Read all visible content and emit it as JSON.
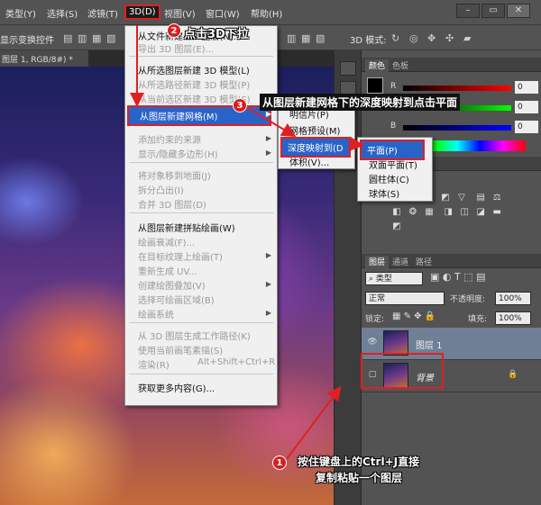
{
  "menubar": {
    "items": [
      "类型(Y)",
      "选择(S)",
      "滤镜(T)",
      "3D(D)",
      "视图(V)",
      "窗口(W)",
      "帮助(H)"
    ],
    "window_controls": [
      "minimize-icon",
      "restore-icon",
      "close-icon"
    ]
  },
  "options_bar": {
    "show_transform": "显示变换控件",
    "mode_label": "3D 模式:"
  },
  "document": {
    "tab_title": "图层 1, RGB/8#) *"
  },
  "menu3d": {
    "items": [
      {
        "label": "从文件新建 3D 图层(N)...",
        "disabled": false
      },
      {
        "label": "导出 3D 图层(E)...",
        "disabled": true
      },
      {
        "label": "从所选图层新建 3D 模型(L)",
        "disabled": false
      },
      {
        "label": "从所选路径新建 3D 模型(P)",
        "disabled": true
      },
      {
        "label": "从当前选区新建 3D 模型(S)",
        "disabled": true
      },
      {
        "label": "从图层新建网格(M)",
        "disabled": false,
        "highlighted": true,
        "submenu": true
      },
      {
        "label": "添加约束的来源",
        "disabled": true,
        "submenu": true
      },
      {
        "label": "显示/隐藏多边形(H)",
        "disabled": true,
        "submenu": true
      },
      {
        "label": "将对象移到地面(J)",
        "disabled": true
      },
      {
        "label": "拆分凸出(I)",
        "disabled": true
      },
      {
        "label": "合并 3D 图层(D)",
        "disabled": true
      },
      {
        "label": "从图层新建拼贴绘画(W)",
        "disabled": false
      },
      {
        "label": "绘画衰减(F)...",
        "disabled": true
      },
      {
        "label": "在目标纹理上绘画(T)",
        "disabled": true,
        "submenu": true
      },
      {
        "label": "重新生成 UV...",
        "disabled": true
      },
      {
        "label": "创建绘图叠加(V)",
        "disabled": true,
        "submenu": true
      },
      {
        "label": "选择可绘画区域(B)",
        "disabled": true
      },
      {
        "label": "绘画系统",
        "disabled": true,
        "submenu": true
      },
      {
        "label": "从 3D 图层生成工作路径(K)",
        "disabled": true
      },
      {
        "label": "使用当前画笔素描(S)",
        "disabled": true
      },
      {
        "label": "渲染(R)",
        "disabled": true,
        "shortcut": "Alt+Shift+Ctrl+R"
      },
      {
        "label": "获取更多内容(G)...",
        "disabled": false
      }
    ]
  },
  "submenu_mesh": {
    "items": [
      "明信片(P)",
      "网格预设(M)",
      "深度映射到(D",
      "体积(V)..."
    ]
  },
  "submenu_depth": {
    "items": [
      "平面(P)",
      "双面平面(T)",
      "圆柱体(C)",
      "球体(S)"
    ]
  },
  "color_panel": {
    "tabs": [
      "颜色",
      "色板"
    ],
    "sliders": [
      {
        "label": "R",
        "value": "0"
      },
      {
        "label": "G",
        "value": "0"
      },
      {
        "label": "B",
        "value": "0"
      }
    ]
  },
  "layers_panel": {
    "tabs": [
      "图层",
      "通道",
      "路径"
    ],
    "filter_label": "类型",
    "blend_mode": "正常",
    "opacity_label": "不透明度:",
    "opacity_value": "100%",
    "lock_label": "锁定:",
    "fill_label": "填充:",
    "fill_value": "100%",
    "layers": [
      {
        "name": "图层 1",
        "selected": true,
        "visible": true
      },
      {
        "name": "背景",
        "selected": false,
        "visible": false,
        "locked": true
      }
    ]
  },
  "annotations": {
    "step1_badge": "1",
    "step1_line1": "按住键盘上的Ctrl+J直接",
    "step1_line2": "复制粘贴一个图层",
    "step2_badge": "2",
    "step2_text": "点击3D下拉",
    "step3_badge": "3",
    "step3_text": "从图层新建网格下的深度映射到点击平面"
  },
  "colors": {
    "accent_red": "#e02020",
    "menu_highlight": "#2a63c8",
    "layer_selected": "#6f7f96"
  }
}
